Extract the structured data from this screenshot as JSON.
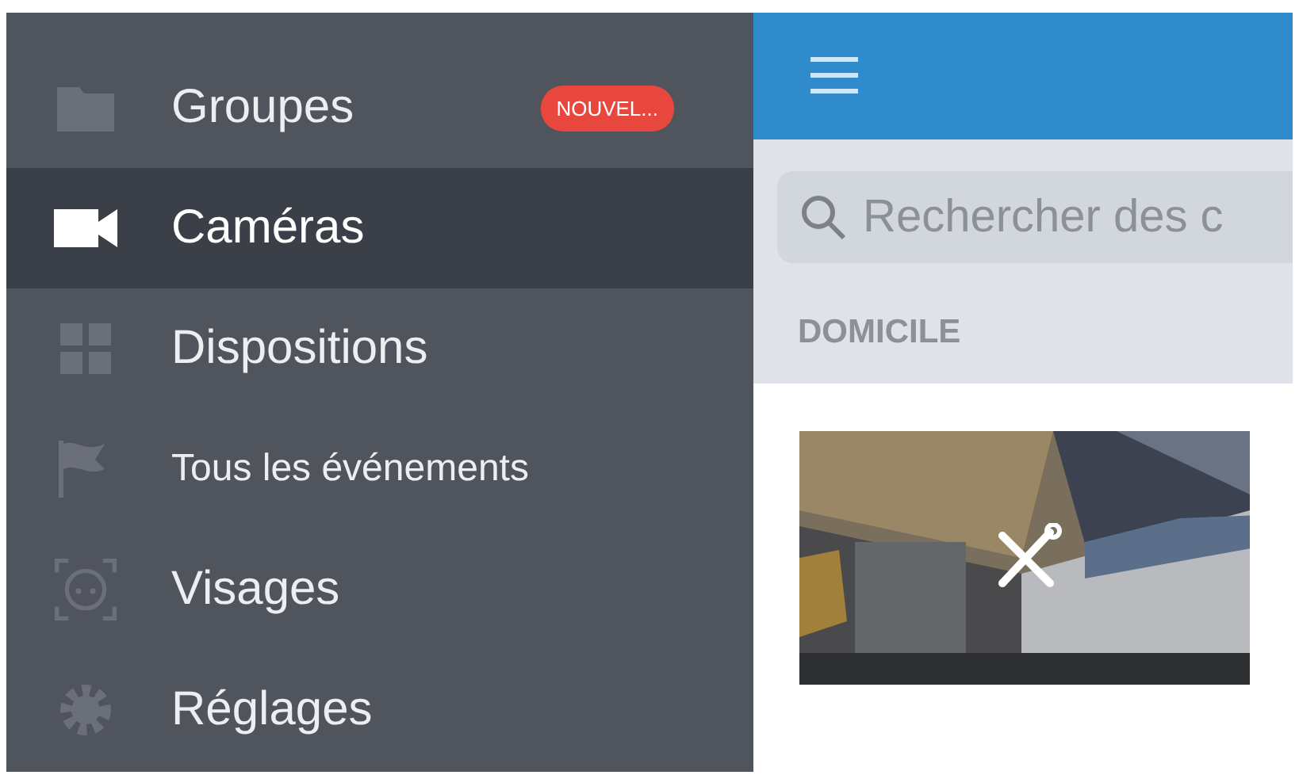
{
  "sidebar": {
    "items": [
      {
        "label": "Groupes",
        "selected": false,
        "badge": "NOUVEL..."
      },
      {
        "label": "Caméras",
        "selected": true
      },
      {
        "label": "Dispositions",
        "selected": false
      },
      {
        "label": "Tous les événements",
        "selected": false,
        "small": true
      },
      {
        "label": "Visages",
        "selected": false
      },
      {
        "label": "Réglages",
        "selected": false
      }
    ]
  },
  "search": {
    "placeholder": "Rechercher des c"
  },
  "section": {
    "title": "DOMICILE"
  },
  "cameras": [
    {
      "kind": "picture",
      "maintenance": true
    }
  ]
}
